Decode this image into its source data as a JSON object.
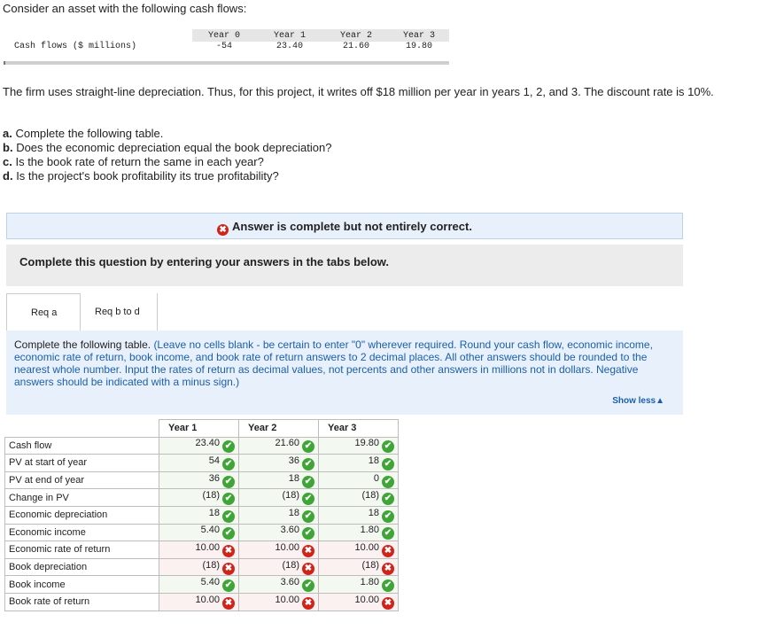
{
  "intro": "Consider an asset with the following cash flows:",
  "cashflow_table": {
    "headers": [
      "Year 0",
      "Year 1",
      "Year 2",
      "Year 3"
    ],
    "row_label": "Cash flows ($ millions)",
    "values": [
      "-54",
      "23.40",
      "21.60",
      "19.80"
    ]
  },
  "description": "The firm uses straight-line depreciation. Thus, for this project, it writes off $18 million per year in years 1, 2, and 3. The discount rate is 10%.",
  "questions": [
    {
      "letter": "a.",
      "text": "Complete the following table."
    },
    {
      "letter": "b.",
      "text": "Does the economic depreciation equal the book depreciation?"
    },
    {
      "letter": "c.",
      "text": "Is the book rate of return the same in each year?"
    },
    {
      "letter": "d.",
      "text": "Is the project's book profitability its true profitability?"
    }
  ],
  "banner": "Answer is complete but not entirely correct.",
  "complete_prompt": "Complete this question by entering your answers in the tabs below.",
  "tabs": [
    "Req a",
    "Req b to d"
  ],
  "instruction": {
    "lead": "Complete the following table.",
    "detail": "(Leave no cells blank - be certain to enter \"0\" wherever required. Round your cash flow, economic income, economic rate of return, book income, and book rate of return answers to 2 decimal places. All other answers should be rounded to the nearest whole number. Input the rates of return as decimal values, not percents and other answers in millions not in dollars. Negative answers should be indicated with a minus sign.)"
  },
  "show_less": "Show less▲",
  "answer_table": {
    "columns": [
      "Year 1",
      "Year 2",
      "Year 3"
    ],
    "rows": [
      {
        "label": "Cash flow",
        "values": [
          "23.40",
          "21.60",
          "19.80"
        ],
        "status": [
          "ok",
          "ok",
          "ok"
        ]
      },
      {
        "label": "PV at start of year",
        "values": [
          "54",
          "36",
          "18"
        ],
        "status": [
          "ok",
          "ok",
          "ok"
        ]
      },
      {
        "label": "PV at end of year",
        "values": [
          "36",
          "18",
          "0"
        ],
        "status": [
          "ok",
          "ok",
          "ok"
        ]
      },
      {
        "label": "Change in PV",
        "values": [
          "(18)",
          "(18)",
          "(18)"
        ],
        "status": [
          "ok",
          "ok",
          "ok"
        ]
      },
      {
        "label": "Economic depreciation",
        "values": [
          "18",
          "18",
          "18"
        ],
        "status": [
          "ok",
          "ok",
          "ok"
        ]
      },
      {
        "label": "Economic income",
        "values": [
          "5.40",
          "3.60",
          "1.80"
        ],
        "status": [
          "ok",
          "ok",
          "ok"
        ]
      },
      {
        "label": "Economic rate of return",
        "values": [
          "10.00",
          "10.00",
          "10.00"
        ],
        "status": [
          "bad",
          "bad",
          "bad"
        ]
      },
      {
        "label": "Book depreciation",
        "values": [
          "(18)",
          "(18)",
          "(18)"
        ],
        "status": [
          "bad",
          "bad",
          "bad"
        ]
      },
      {
        "label": "Book income",
        "values": [
          "5.40",
          "3.60",
          "1.80"
        ],
        "status": [
          "ok",
          "ok",
          "ok"
        ]
      },
      {
        "label": "Book rate of return",
        "values": [
          "10.00",
          "10.00",
          "10.00"
        ],
        "status": [
          "bad",
          "bad",
          "bad"
        ]
      }
    ]
  },
  "icons": {
    "ok": "✔",
    "bad": "✖"
  },
  "colors": {
    "correct": "#3ea536",
    "incorrect": "#d0241b",
    "info_bg": "#e8f1fb"
  }
}
